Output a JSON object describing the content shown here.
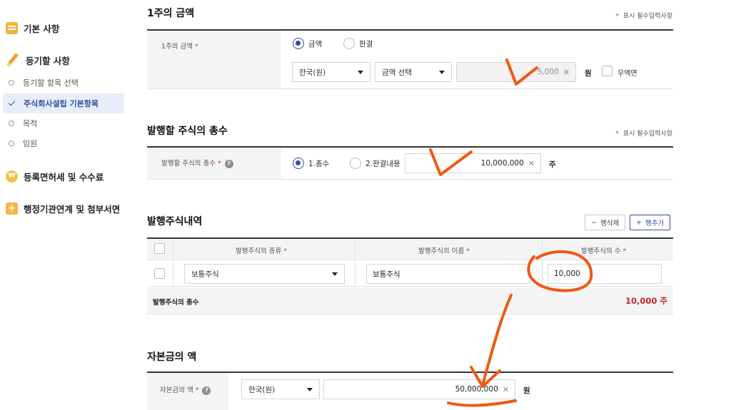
{
  "sidebar": {
    "basic": "기본 사항",
    "register": "등기할 사항",
    "sub_items": [
      "등기할 항목 선택",
      "주식회사설립 기본항목",
      "목적",
      "임원"
    ],
    "fees": "등록면허세 및 수수료",
    "attachments": "행정기관연계 및 첨부서면",
    "coin_glyph": "₩"
  },
  "required_note": "표시 필수입력사항",
  "star": "*",
  "per_share": {
    "title": "1주의 금액",
    "label": "1주의 금액",
    "radio_amount": "금액",
    "radio_judgment": "판결",
    "currency": "한국(원)",
    "amount_select": "금액 선택",
    "amount_value": "5,000",
    "unit": "원",
    "free_label": "무액면"
  },
  "total_shares": {
    "title": "발행할 주식의 총수",
    "label": "발행할 주식의 총수",
    "radio_total": "1.총수",
    "radio_judgment": "2.판결내용",
    "value": "10,000,000",
    "unit": "주"
  },
  "issued": {
    "title": "발행주식내역",
    "delete_btn": "행삭제",
    "add_btn": "행추가",
    "col_type": "발행주식의 종류",
    "col_name": "발행주식의 이름",
    "col_count": "발행주식의 수",
    "rows": [
      {
        "type": "보통주식",
        "name": "보통주식",
        "count": "10,000"
      }
    ],
    "total_label": "발행주식의 총수",
    "total_value": "10,000 주"
  },
  "capital": {
    "title": "자본금의 액",
    "label": "자본금의 액",
    "currency": "한국(원)",
    "value": "50,000,000",
    "unit": "원"
  },
  "icons": {
    "help": "question-icon",
    "clear": "close-icon",
    "caret": "caret-down-icon"
  },
  "colors": {
    "accent": "#2d4ea5",
    "required": "#d33333",
    "total": "#c62828",
    "annotation": "#ee5a12"
  }
}
